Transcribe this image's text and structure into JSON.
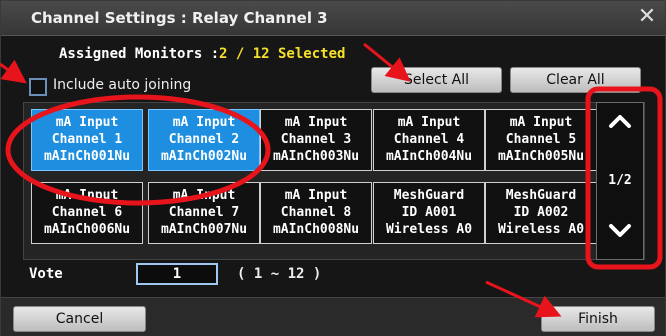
{
  "dialog": {
    "title": "Channel Settings : Relay Channel 3",
    "close_glyph": "✕"
  },
  "assigned": {
    "label": "Assigned Monitors :",
    "value": "2 / 12 Selected"
  },
  "auto_joining": {
    "label": "Include auto joining",
    "checked": false
  },
  "buttons": {
    "select_all": "Select All",
    "clear_all": "Clear All",
    "cancel": "Cancel",
    "finish": "Finish"
  },
  "monitors": [
    {
      "line1": "mA Input",
      "line2": "Channel 1",
      "line3": "mAInCh001Nu",
      "selected": true
    },
    {
      "line1": "mA Input",
      "line2": "Channel 2",
      "line3": "mAInCh002Nu",
      "selected": true
    },
    {
      "line1": "mA Input",
      "line2": "Channel 3",
      "line3": "mAInCh003Nu",
      "selected": false
    },
    {
      "line1": "mA Input",
      "line2": "Channel 4",
      "line3": "mAInCh004Nu",
      "selected": false
    },
    {
      "line1": "mA Input",
      "line2": "Channel 5",
      "line3": "mAInCh005Nu",
      "selected": false
    },
    {
      "line1": "mA Input",
      "line2": "Channel 6",
      "line3": "mAInCh006Nu",
      "selected": false
    },
    {
      "line1": "mA Input",
      "line2": "Channel 7",
      "line3": "mAInCh007Nu",
      "selected": false
    },
    {
      "line1": "mA Input",
      "line2": "Channel 8",
      "line3": "mAInCh008Nu",
      "selected": false
    },
    {
      "line1": "MeshGuard",
      "line2": "ID A001",
      "line3": "Wireless A0",
      "selected": false
    },
    {
      "line1": "MeshGuard",
      "line2": "ID A002",
      "line3": "Wireless A0",
      "selected": false
    }
  ],
  "pager": {
    "up_icon": "chevron-up-icon",
    "down_icon": "chevron-down-icon",
    "up_glyph": "⌃",
    "down_glyph": "⌄",
    "page": "1/2"
  },
  "vote": {
    "label": "Vote",
    "value": "1",
    "range": "( 1 ~ 12 )"
  },
  "colors": {
    "selected_tile": "#1e8fe0",
    "assigned_value": "#f5e12a",
    "annotation": "#e8141c"
  }
}
